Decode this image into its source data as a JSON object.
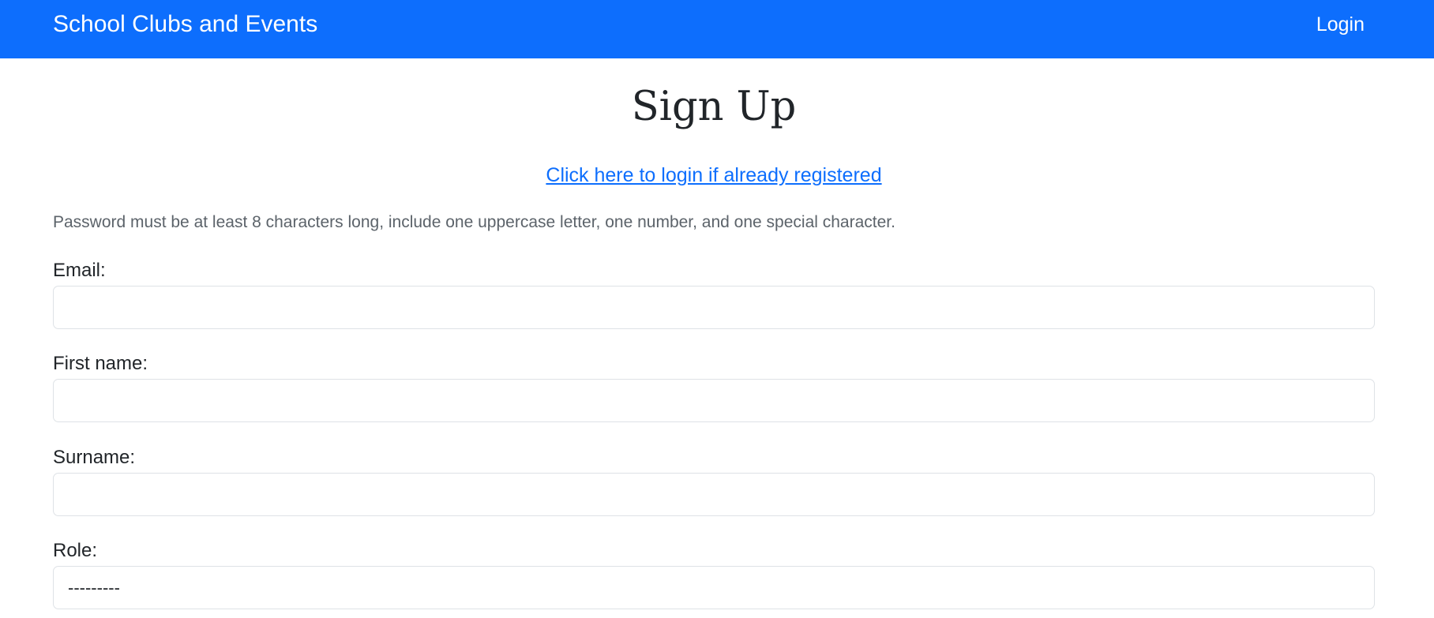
{
  "navbar": {
    "brand": "School Clubs and Events",
    "login_label": "Login",
    "background_color": "#0d6efd"
  },
  "main": {
    "title": "Sign Up",
    "login_link_text": "Click here to login if already registered",
    "password_help": "Password must be at least 8 characters long, include one uppercase letter, one number, and one special character."
  },
  "form": {
    "email": {
      "label": "Email:",
      "value": ""
    },
    "first_name": {
      "label": "First name:",
      "value": ""
    },
    "surname": {
      "label": "Surname:",
      "value": ""
    },
    "role": {
      "label": "Role:",
      "selected": "---------"
    }
  }
}
